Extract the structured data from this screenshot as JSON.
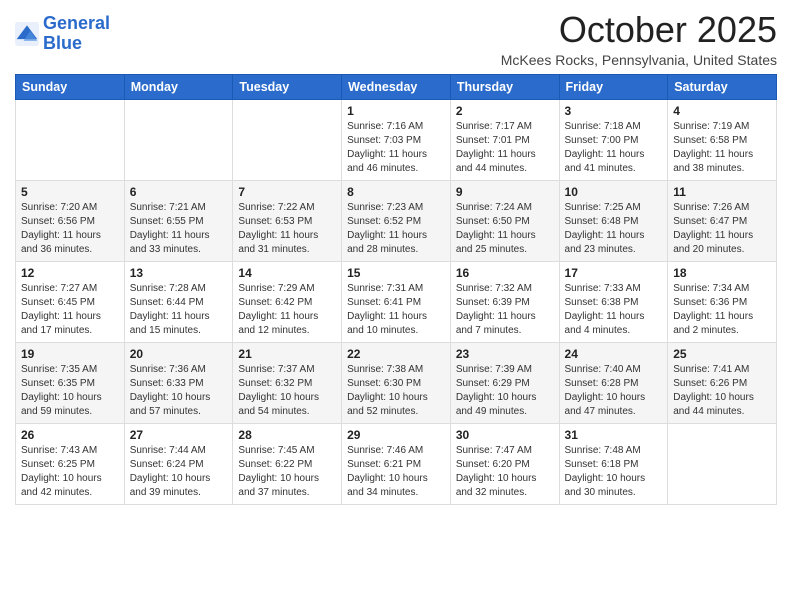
{
  "logo": {
    "line1": "General",
    "line2": "Blue"
  },
  "title": "October 2025",
  "location": "McKees Rocks, Pennsylvania, United States",
  "days_of_week": [
    "Sunday",
    "Monday",
    "Tuesday",
    "Wednesday",
    "Thursday",
    "Friday",
    "Saturday"
  ],
  "weeks": [
    [
      {
        "day": "",
        "info": ""
      },
      {
        "day": "",
        "info": ""
      },
      {
        "day": "",
        "info": ""
      },
      {
        "day": "1",
        "info": "Sunrise: 7:16 AM\nSunset: 7:03 PM\nDaylight: 11 hours and 46 minutes."
      },
      {
        "day": "2",
        "info": "Sunrise: 7:17 AM\nSunset: 7:01 PM\nDaylight: 11 hours and 44 minutes."
      },
      {
        "day": "3",
        "info": "Sunrise: 7:18 AM\nSunset: 7:00 PM\nDaylight: 11 hours and 41 minutes."
      },
      {
        "day": "4",
        "info": "Sunrise: 7:19 AM\nSunset: 6:58 PM\nDaylight: 11 hours and 38 minutes."
      }
    ],
    [
      {
        "day": "5",
        "info": "Sunrise: 7:20 AM\nSunset: 6:56 PM\nDaylight: 11 hours and 36 minutes."
      },
      {
        "day": "6",
        "info": "Sunrise: 7:21 AM\nSunset: 6:55 PM\nDaylight: 11 hours and 33 minutes."
      },
      {
        "day": "7",
        "info": "Sunrise: 7:22 AM\nSunset: 6:53 PM\nDaylight: 11 hours and 31 minutes."
      },
      {
        "day": "8",
        "info": "Sunrise: 7:23 AM\nSunset: 6:52 PM\nDaylight: 11 hours and 28 minutes."
      },
      {
        "day": "9",
        "info": "Sunrise: 7:24 AM\nSunset: 6:50 PM\nDaylight: 11 hours and 25 minutes."
      },
      {
        "day": "10",
        "info": "Sunrise: 7:25 AM\nSunset: 6:48 PM\nDaylight: 11 hours and 23 minutes."
      },
      {
        "day": "11",
        "info": "Sunrise: 7:26 AM\nSunset: 6:47 PM\nDaylight: 11 hours and 20 minutes."
      }
    ],
    [
      {
        "day": "12",
        "info": "Sunrise: 7:27 AM\nSunset: 6:45 PM\nDaylight: 11 hours and 17 minutes."
      },
      {
        "day": "13",
        "info": "Sunrise: 7:28 AM\nSunset: 6:44 PM\nDaylight: 11 hours and 15 minutes."
      },
      {
        "day": "14",
        "info": "Sunrise: 7:29 AM\nSunset: 6:42 PM\nDaylight: 11 hours and 12 minutes."
      },
      {
        "day": "15",
        "info": "Sunrise: 7:31 AM\nSunset: 6:41 PM\nDaylight: 11 hours and 10 minutes."
      },
      {
        "day": "16",
        "info": "Sunrise: 7:32 AM\nSunset: 6:39 PM\nDaylight: 11 hours and 7 minutes."
      },
      {
        "day": "17",
        "info": "Sunrise: 7:33 AM\nSunset: 6:38 PM\nDaylight: 11 hours and 4 minutes."
      },
      {
        "day": "18",
        "info": "Sunrise: 7:34 AM\nSunset: 6:36 PM\nDaylight: 11 hours and 2 minutes."
      }
    ],
    [
      {
        "day": "19",
        "info": "Sunrise: 7:35 AM\nSunset: 6:35 PM\nDaylight: 10 hours and 59 minutes."
      },
      {
        "day": "20",
        "info": "Sunrise: 7:36 AM\nSunset: 6:33 PM\nDaylight: 10 hours and 57 minutes."
      },
      {
        "day": "21",
        "info": "Sunrise: 7:37 AM\nSunset: 6:32 PM\nDaylight: 10 hours and 54 minutes."
      },
      {
        "day": "22",
        "info": "Sunrise: 7:38 AM\nSunset: 6:30 PM\nDaylight: 10 hours and 52 minutes."
      },
      {
        "day": "23",
        "info": "Sunrise: 7:39 AM\nSunset: 6:29 PM\nDaylight: 10 hours and 49 minutes."
      },
      {
        "day": "24",
        "info": "Sunrise: 7:40 AM\nSunset: 6:28 PM\nDaylight: 10 hours and 47 minutes."
      },
      {
        "day": "25",
        "info": "Sunrise: 7:41 AM\nSunset: 6:26 PM\nDaylight: 10 hours and 44 minutes."
      }
    ],
    [
      {
        "day": "26",
        "info": "Sunrise: 7:43 AM\nSunset: 6:25 PM\nDaylight: 10 hours and 42 minutes."
      },
      {
        "day": "27",
        "info": "Sunrise: 7:44 AM\nSunset: 6:24 PM\nDaylight: 10 hours and 39 minutes."
      },
      {
        "day": "28",
        "info": "Sunrise: 7:45 AM\nSunset: 6:22 PM\nDaylight: 10 hours and 37 minutes."
      },
      {
        "day": "29",
        "info": "Sunrise: 7:46 AM\nSunset: 6:21 PM\nDaylight: 10 hours and 34 minutes."
      },
      {
        "day": "30",
        "info": "Sunrise: 7:47 AM\nSunset: 6:20 PM\nDaylight: 10 hours and 32 minutes."
      },
      {
        "day": "31",
        "info": "Sunrise: 7:48 AM\nSunset: 6:18 PM\nDaylight: 10 hours and 30 minutes."
      },
      {
        "day": "",
        "info": ""
      }
    ]
  ]
}
